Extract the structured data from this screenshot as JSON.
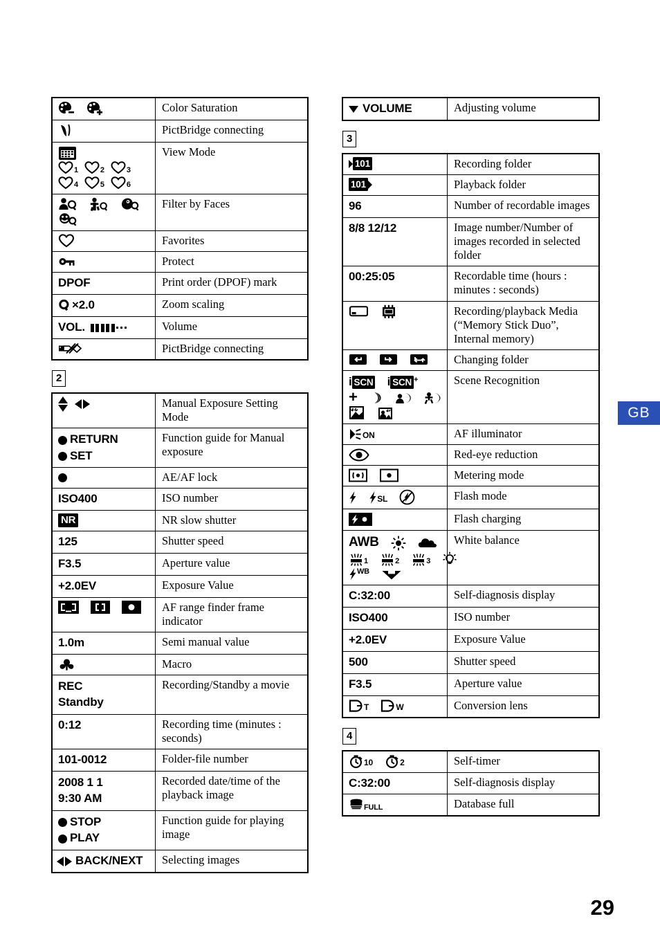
{
  "page": {
    "number": "29",
    "language_tab": "GB"
  },
  "left_column": {
    "table1": {
      "rows": [
        {
          "symbol": "color-saturation-minus-plus",
          "desc": "Color Saturation"
        },
        {
          "symbol": "pictbridge-connecting-swoosh",
          "desc": "PictBridge connecting"
        },
        {
          "symbol": "view-mode-calendar-hearts",
          "desc": "View Mode",
          "hearts": [
            "1",
            "2",
            "3",
            "4",
            "5",
            "6"
          ]
        },
        {
          "symbol": "filter-by-faces",
          "desc": "Filter by Faces"
        },
        {
          "symbol": "favorites-heart",
          "desc": "Favorites"
        },
        {
          "symbol": "protect-key",
          "desc": "Protect"
        },
        {
          "symbol": "dpof",
          "desc": "Print order (DPOF) mark",
          "label": "DPOF"
        },
        {
          "symbol": "zoom-scaling",
          "desc": "Zoom scaling",
          "label": "×2.0"
        },
        {
          "symbol": "volume-bars",
          "desc": "Volume",
          "label": "VOL."
        },
        {
          "symbol": "pictbridge-disconnect",
          "desc": "PictBridge connecting"
        }
      ]
    },
    "section2": {
      "badge": "2",
      "rows": [
        {
          "symbol": "arrows-updown-leftright",
          "desc": "Manual Exposure Setting Mode"
        },
        {
          "symbol": "return-set-buttons",
          "desc": "Function guide for Manual exposure",
          "label_1": "RETURN",
          "label_2": "SET"
        },
        {
          "symbol": "ae-af-lock-dot",
          "desc": "AE/AF lock"
        },
        {
          "symbol": "iso-number",
          "desc": "ISO number",
          "label": "ISO400"
        },
        {
          "symbol": "nr-slow-shutter",
          "desc": "NR slow shutter",
          "label": "NR"
        },
        {
          "symbol": "shutter-speed",
          "desc": "Shutter speed",
          "label": "125"
        },
        {
          "symbol": "aperture-value",
          "desc": "Aperture value",
          "label": "F3.5"
        },
        {
          "symbol": "exposure-value",
          "desc": "Exposure Value",
          "label": "+2.0EV"
        },
        {
          "symbol": "af-range-finder-frames",
          "desc": "AF range finder frame indicator"
        },
        {
          "symbol": "semi-manual-value",
          "desc": "Semi manual value",
          "label": "1.0m"
        },
        {
          "symbol": "macro-flower",
          "desc": "Macro"
        },
        {
          "symbol": "rec-standby",
          "desc": "Recording/Standby a movie",
          "label_1": "REC",
          "label_2": "Standby"
        },
        {
          "symbol": "recording-time",
          "desc": "Recording time (minutes : seconds)",
          "label": "0:12"
        },
        {
          "symbol": "folder-file-number",
          "desc": "Folder-file number",
          "label": "101-0012"
        },
        {
          "symbol": "recorded-datetime",
          "desc": "Recorded date/time of the playback image",
          "label_1": "2008 1 1",
          "label_2": "9:30 AM"
        },
        {
          "symbol": "stop-play-buttons",
          "desc": "Function guide for playing image",
          "label_1": "STOP",
          "label_2": "PLAY"
        },
        {
          "symbol": "back-next",
          "desc": "Selecting images",
          "label": "BACK/NEXT"
        }
      ]
    }
  },
  "right_column": {
    "table_volume": {
      "rows": [
        {
          "symbol": "volume-adjust",
          "desc": "Adjusting volume",
          "label": "VOLUME"
        }
      ]
    },
    "section3": {
      "badge": "3",
      "rows": [
        {
          "symbol": "recording-folder",
          "desc": "Recording folder",
          "label": "101"
        },
        {
          "symbol": "playback-folder",
          "desc": "Playback folder",
          "label": "101"
        },
        {
          "symbol": "recordable-images",
          "desc": "Number of recordable images",
          "label": "96"
        },
        {
          "symbol": "image-number",
          "desc": "Image number/Number of images recorded in selected folder",
          "label": "8/8 12/12"
        },
        {
          "symbol": "recordable-time",
          "desc": "Recordable time (hours : minutes : seconds)",
          "label": "00:25:05"
        },
        {
          "symbol": "media-memorystick-internal",
          "desc": "Recording/playback Media (“Memory Stick Duo”, Internal memory)"
        },
        {
          "symbol": "changing-folder",
          "desc": "Changing folder"
        },
        {
          "symbol": "scene-recognition",
          "desc": "Scene Recognition",
          "label_1": "i",
          "label_2": "SCN"
        },
        {
          "symbol": "af-illuminator",
          "desc": "AF illuminator",
          "label": "ON"
        },
        {
          "symbol": "red-eye-reduction",
          "desc": "Red-eye reduction"
        },
        {
          "symbol": "metering-mode",
          "desc": "Metering mode"
        },
        {
          "symbol": "flash-mode",
          "desc": "Flash mode",
          "label": "SL"
        },
        {
          "symbol": "flash-charging",
          "desc": "Flash charging"
        },
        {
          "symbol": "white-balance",
          "desc": "White balance",
          "label": "AWB",
          "sublabels": [
            "1",
            "2",
            "3",
            "WB"
          ]
        },
        {
          "symbol": "self-diagnosis",
          "desc": "Self-diagnosis display",
          "label": "C:32:00"
        },
        {
          "symbol": "iso-number",
          "desc": "ISO number",
          "label": "ISO400"
        },
        {
          "symbol": "exposure-value",
          "desc": "Exposure Value",
          "label": "+2.0EV"
        },
        {
          "symbol": "shutter-speed",
          "desc": "Shutter speed",
          "label": "500"
        },
        {
          "symbol": "aperture-value",
          "desc": "Aperture value",
          "label": "F3.5"
        },
        {
          "symbol": "conversion-lens",
          "desc": "Conversion lens",
          "label_1": "T",
          "label_2": "W"
        }
      ]
    },
    "section4": {
      "badge": "4",
      "rows": [
        {
          "symbol": "self-timer",
          "desc": "Self-timer",
          "label_1": "10",
          "label_2": "2"
        },
        {
          "symbol": "self-diagnosis",
          "desc": "Self-diagnosis display",
          "label": "C:32:00"
        },
        {
          "symbol": "database-full",
          "desc": "Database full",
          "label": "FULL"
        }
      ]
    }
  }
}
